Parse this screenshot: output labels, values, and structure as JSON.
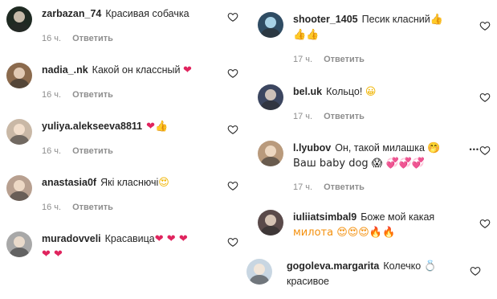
{
  "left_comments": [
    {
      "user": "zarbazan_74",
      "text": "Красивая собачка",
      "emoji": "",
      "emoji_line2": "",
      "time": "16 ч.",
      "reply": "Ответить"
    },
    {
      "user": "nadia_.nk",
      "text": "Какой он классный",
      "emoji": "❤",
      "emoji_line2": "",
      "time": "16 ч.",
      "reply": "Ответить"
    },
    {
      "user": "yuliya.alekseeva8811",
      "text": "",
      "emoji": "❤👍",
      "emoji_line2": "",
      "time": "16 ч.",
      "reply": "Ответить"
    },
    {
      "user": "anastasia0f",
      "text": "Які класнючі",
      "emoji": "😍",
      "emoji_line2": "",
      "time": "16 ч.",
      "reply": "Ответить"
    },
    {
      "user": "muradovveli",
      "text": "Красавица",
      "emoji": "❤ ❤ ❤",
      "emoji_line2": "❤ ❤",
      "time": "",
      "reply": ""
    }
  ],
  "right_comments": [
    {
      "user": "shooter_1405",
      "text": "Песик класний",
      "emoji": "👍",
      "emoji_line2": "👍👍",
      "time": "17 ч.",
      "reply": "Ответить"
    },
    {
      "user": "bel.uk",
      "text": "Кольцо!",
      "emoji": "😀",
      "emoji_line2": "",
      "time": "17 ч.",
      "reply": "Ответить"
    },
    {
      "user": "l.lyubov",
      "text": "Он, такой милашка",
      "emoji": "🤭",
      "emoji_line2": "Ваш baby dog 😱 💞💞💞",
      "time": "17 ч.",
      "reply": "Ответить"
    },
    {
      "user": "iuliiatsimbal9",
      "text": "Боже мой какая",
      "emoji": "",
      "emoji_line2": "милота 😍😍😍🔥🔥",
      "time": "",
      "reply": ""
    },
    {
      "user": "gogoleva.margarita",
      "text": "Колечко",
      "emoji": "💍",
      "emoji_line2": "красивое",
      "time": "",
      "reply": ""
    }
  ],
  "more_options_glyph": "•••",
  "colors": {
    "text": "#262626",
    "meta": "#8e8e8e",
    "heart_outline": "#262626"
  }
}
